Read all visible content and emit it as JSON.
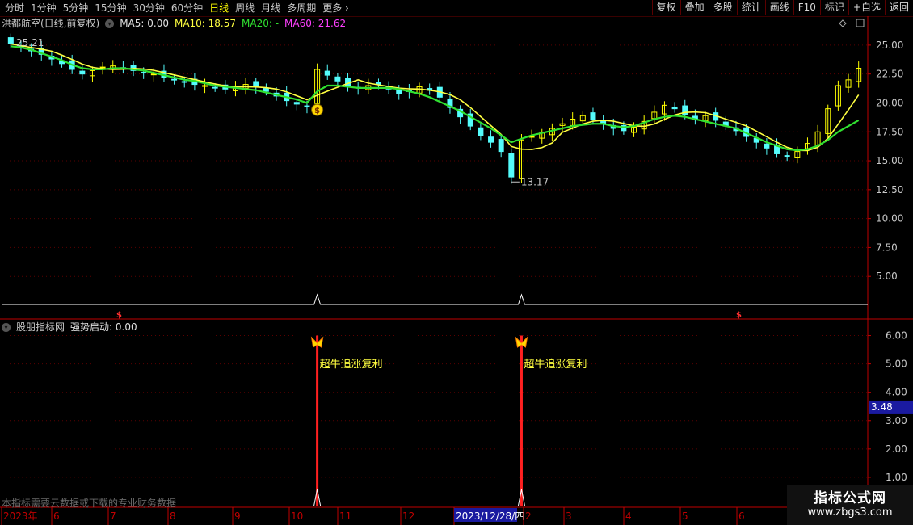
{
  "toolbar": {
    "periods": [
      "分时",
      "1分钟",
      "5分钟",
      "15分钟",
      "30分钟",
      "60分钟",
      "日线",
      "周线",
      "月线",
      "多周期",
      "更多"
    ],
    "active_period": "日线",
    "right_buttons": [
      "复权",
      "叠加",
      "多股",
      "统计",
      "画线",
      "F10",
      "标记",
      "+自选",
      "返回"
    ]
  },
  "main_legend": {
    "title": "洪都航空(日线,前复权)",
    "ma5": "MA5: 0.00",
    "ma10": "MA10: 18.57",
    "ma20": "MA20: -",
    "ma60": "MA60: 21.62"
  },
  "main_axis_ticks": [
    "25.00",
    "22.50",
    "20.00",
    "17.50",
    "15.00",
    "12.50",
    "10.00",
    "7.50",
    "5.00"
  ],
  "price_labels": {
    "high": "25.21",
    "low": "13.17"
  },
  "indicator_legend": {
    "name": "股朋指标网",
    "label": "强势启动: 0.00"
  },
  "indicator_axis_ticks": [
    "6.00",
    "5.00",
    "4.00",
    "3.00",
    "2.00",
    "1.00"
  ],
  "current_value": "3.48",
  "signal_text": "超牛追涨复利",
  "notice": "本指标需要云数据或下载的专业财务数据",
  "date_axis": [
    "2023年",
    "6",
    "7",
    "8",
    "9",
    "10",
    "11",
    "12",
    "2023/12/28/四",
    "2",
    "3",
    "4",
    "5",
    "6"
  ],
  "watermark": {
    "title": "指标公式网",
    "url": "www.zbgs3.com"
  },
  "colors": {
    "up": "#ffff00",
    "down": "#54fcfc",
    "ma10": "#ffff40",
    "ma20": "#30e030",
    "ma60": "#ff40ff",
    "signal": "#ff2020",
    "axis": "#c00000"
  },
  "chart_data": {
    "type": "candlestick",
    "ylim": [
      2.5,
      26.25
    ],
    "indicator_ylim": [
      0,
      6.5
    ],
    "close_series": [
      25.1,
      24.8,
      24.5,
      24.2,
      23.8,
      23.4,
      22.9,
      22.5,
      22.8,
      23.1,
      23.2,
      23.0,
      22.8,
      22.6,
      22.5,
      22.2,
      22.0,
      21.8,
      21.6,
      21.5,
      21.3,
      21.2,
      21.4,
      21.6,
      21.4,
      21.0,
      20.6,
      20.2,
      19.9,
      19.7,
      22.9,
      22.4,
      21.9,
      21.5,
      21.3,
      21.5,
      21.6,
      21.2,
      20.8,
      21.0,
      21.4,
      21.1,
      20.5,
      19.6,
      18.8,
      18.0,
      17.2,
      16.6,
      15.8,
      13.6,
      16.8,
      17.1,
      17.4,
      17.8,
      18.2,
      18.6,
      18.9,
      18.6,
      18.2,
      17.8,
      17.6,
      17.9,
      18.4,
      19.2,
      19.8,
      19.5,
      19.0,
      18.6,
      18.9,
      18.5,
      18.0,
      17.6,
      17.1,
      16.6,
      16.1,
      15.6,
      15.4,
      15.8,
      16.5,
      17.5,
      19.5,
      21.5,
      22.0,
      23.0
    ],
    "ma20_series": [
      24.9,
      24.8,
      24.6,
      24.3,
      24.0,
      23.7,
      23.3,
      23.0,
      22.9,
      22.9,
      23.0,
      23.0,
      22.9,
      22.8,
      22.6,
      22.4,
      22.2,
      22.0,
      21.9,
      21.7,
      21.5,
      21.4,
      21.3,
      21.2,
      21.1,
      20.9,
      20.7,
      20.5,
      20.3,
      20.0,
      21.0,
      21.5,
      21.5,
      21.4,
      21.3,
      21.3,
      21.3,
      21.3,
      21.2,
      21.0,
      20.8,
      20.5,
      20.1,
      19.7,
      19.3,
      18.8,
      18.3,
      17.8,
      17.2,
      16.6,
      16.9,
      17.2,
      17.4,
      17.6,
      17.8,
      18.0,
      18.1,
      18.2,
      18.2,
      18.0,
      17.9,
      18.0,
      18.3,
      18.6,
      18.8,
      18.9,
      18.8,
      18.6,
      18.4,
      18.2,
      18.0,
      17.8,
      17.4,
      17.0,
      16.6,
      16.3,
      16.0,
      15.9,
      16.0,
      16.3,
      16.8,
      17.5,
      18.0,
      18.5
    ],
    "signal_indices": [
      30,
      50
    ],
    "signal_value": 6.0
  }
}
